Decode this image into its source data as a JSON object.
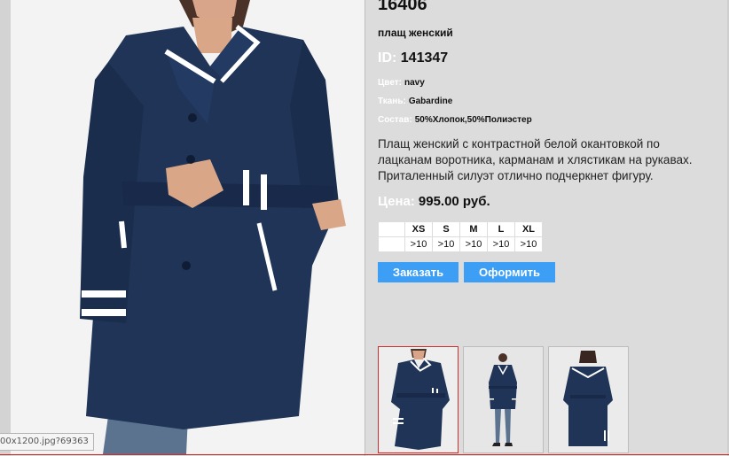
{
  "product": {
    "article": "16406",
    "name": "плащ женский",
    "id_label": "ID:",
    "id_value": "141347",
    "attributes": [
      {
        "label": "Цвет:",
        "value": "navy"
      },
      {
        "label": "Ткань:",
        "value": "Gabardine"
      },
      {
        "label": "Состав:",
        "value": "50%Хлопок,50%Полиэстер"
      }
    ],
    "description": "Плащ женский с контрастной белой окантовкой по лацканам воротника, карманам и хлястикам на рукавах. Приталенный силуэт отлично подчеркнет фигуру.",
    "price_label": "Цена:",
    "price_value": "995.00 руб."
  },
  "sizes": {
    "header": [
      "",
      "XS",
      "S",
      "M",
      "L",
      "XL"
    ],
    "stock": [
      "",
      ">10",
      ">10",
      ">10",
      ">10",
      ">10"
    ]
  },
  "buttons": {
    "order": "Заказать",
    "checkout": "Оформить"
  },
  "thumbnails": [
    {
      "name": "front-view",
      "selected": true
    },
    {
      "name": "full-length-view",
      "selected": false
    },
    {
      "name": "back-view",
      "selected": false
    }
  ],
  "status": {
    "url_tooltip": "00x1200.jpg?69363"
  },
  "colors": {
    "coat": "#1f3457",
    "trim": "#ffffff",
    "button_bg": "#3d9ef6",
    "selected_border": "#c9302c",
    "label_white": "#ffffff"
  }
}
